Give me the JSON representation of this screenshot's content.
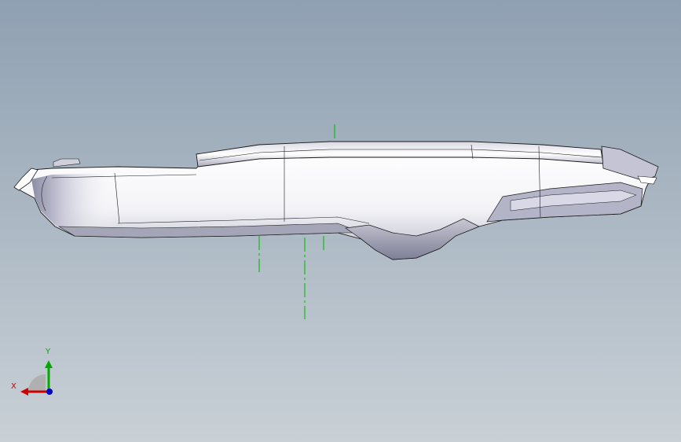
{
  "viewport": {
    "background_top": "#8fa0b2",
    "background_bottom": "#c9d0d6"
  },
  "model": {
    "fill": "#ffffff",
    "edge_color": "#1a1a1a",
    "shade_color": "#9a9ab0",
    "centerline_color": "#00c000"
  },
  "triad": {
    "x_label": "X",
    "y_label": "Y",
    "x_color": "#cc0000",
    "y_color": "#00aa00",
    "z_color": "#0000cc"
  }
}
